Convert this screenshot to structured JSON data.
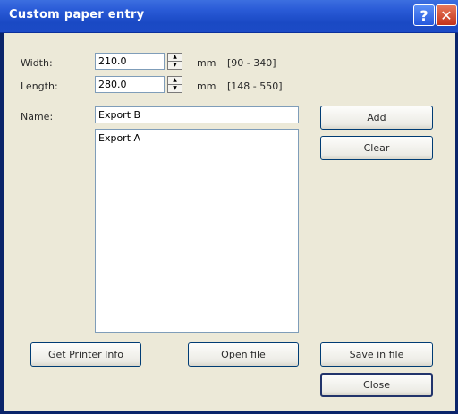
{
  "window": {
    "title": "Custom paper entry",
    "help_icon": "help-icon",
    "close_icon": "close-icon"
  },
  "width": {
    "label": "Width:",
    "value": "210.0",
    "unit": "mm",
    "range": "[90 - 340]"
  },
  "length": {
    "label": "Length:",
    "value": "280.0",
    "unit": "mm",
    "range": "[148 - 550]"
  },
  "name": {
    "label": "Name:",
    "value": "Export B"
  },
  "list": {
    "items": [
      "Export A"
    ]
  },
  "buttons": {
    "add": "Add",
    "clear": "Clear",
    "get_printer_info": "Get Printer Info",
    "open_file": "Open file",
    "save_in_file": "Save in file",
    "close": "Close"
  },
  "colors": {
    "titlebar": "#2457dd",
    "dialog_background": "#ece9d8",
    "close_button": "#c3331c"
  }
}
